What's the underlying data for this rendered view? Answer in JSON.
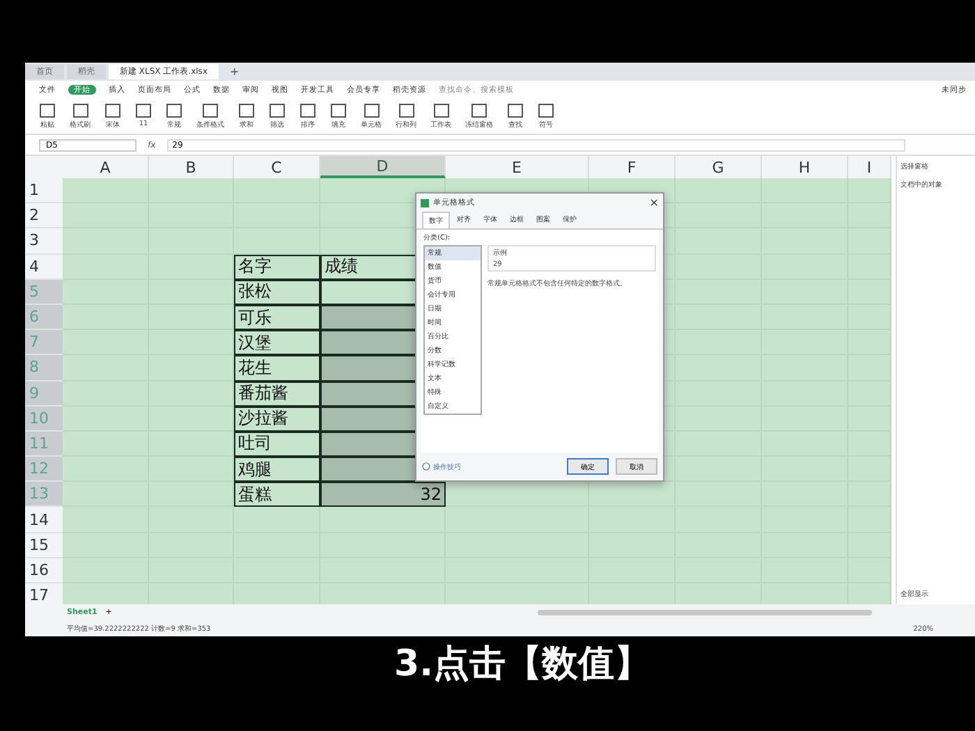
{
  "tabs": [
    {
      "label": "首页",
      "selected": false
    },
    {
      "label": "稻壳",
      "selected": false
    },
    {
      "label": "新建 XLSX 工作表.xlsx",
      "selected": true
    }
  ],
  "menu": [
    {
      "label": "文件",
      "selected": false
    },
    {
      "label": "开始",
      "selected": true
    },
    {
      "label": "插入",
      "selected": false
    },
    {
      "label": "页面布局",
      "selected": false
    },
    {
      "label": "公式",
      "selected": false
    },
    {
      "label": "数据",
      "selected": false
    },
    {
      "label": "审阅",
      "selected": false
    },
    {
      "label": "视图",
      "selected": false
    },
    {
      "label": "开发工具",
      "selected": false
    },
    {
      "label": "会员专享",
      "selected": false
    },
    {
      "label": "稻壳资源",
      "selected": false
    }
  ],
  "search": {
    "placeholder": "查找命令、搜索模板"
  },
  "new_tab": "+",
  "sync": "未同步",
  "toolbar": [
    "粘贴",
    "格式刷",
    "宋体",
    "11",
    "常规",
    "条件格式",
    "求和",
    "筛选",
    "排序",
    "填充",
    "单元格",
    "行和列",
    "工作表",
    "冻结窗格",
    "查找",
    "符号"
  ],
  "formula_bar": {
    "cell_ref": "D5",
    "fx": "fx",
    "value": "29"
  },
  "sheet": {
    "columns": [
      {
        "label": "A",
        "selected": false
      },
      {
        "label": "B",
        "selected": false
      },
      {
        "label": "C",
        "selected": false
      },
      {
        "label": "D",
        "selected": true
      },
      {
        "label": "E",
        "selected": false
      },
      {
        "label": "F",
        "selected": false
      },
      {
        "label": "G",
        "selected": false
      },
      {
        "label": "H",
        "selected": false
      },
      {
        "label": "I",
        "selected": false
      }
    ],
    "rows": [
      {
        "label": "1",
        "selected": false
      },
      {
        "label": "2",
        "selected": false
      },
      {
        "label": "3",
        "selected": false
      },
      {
        "label": "4",
        "selected": false
      },
      {
        "label": "5",
        "selected": true
      },
      {
        "label": "6",
        "selected": true
      },
      {
        "label": "7",
        "selected": true
      },
      {
        "label": "8",
        "selected": true
      },
      {
        "label": "9",
        "selected": true
      },
      {
        "label": "10",
        "selected": true
      },
      {
        "label": "11",
        "selected": true
      },
      {
        "label": "12",
        "selected": true
      },
      {
        "label": "13",
        "selected": true
      },
      {
        "label": "14",
        "selected": false
      },
      {
        "label": "15",
        "selected": false
      },
      {
        "label": "16",
        "selected": false
      },
      {
        "label": "17",
        "selected": false
      }
    ],
    "table": {
      "header": [
        "名字",
        "成绩"
      ],
      "rows": [
        {
          "name": "张松"
        },
        {
          "name": "可乐"
        },
        {
          "name": "汉堡"
        },
        {
          "name": "花生"
        },
        {
          "name": "番茄酱"
        },
        {
          "name": "沙拉酱"
        },
        {
          "name": "吐司"
        },
        {
          "name": "鸡腿"
        },
        {
          "name": "蛋糕",
          "score": "32"
        }
      ]
    }
  },
  "dialog": {
    "title": "单元格格式",
    "close": "×",
    "tabs": [
      {
        "label": "数字",
        "selected": true
      },
      {
        "label": "对齐",
        "selected": false
      },
      {
        "label": "字体",
        "selected": false
      },
      {
        "label": "边框",
        "selected": false
      },
      {
        "label": "图案",
        "selected": false
      },
      {
        "label": "保护",
        "selected": false
      }
    ],
    "category_label": "分类(C):",
    "categories": [
      {
        "label": "常规",
        "selected": true
      },
      {
        "label": "数值",
        "selected": false
      },
      {
        "label": "货币",
        "selected": false
      },
      {
        "label": "会计专用",
        "selected": false
      },
      {
        "label": "日期",
        "selected": false
      },
      {
        "label": "时间",
        "selected": false
      },
      {
        "label": "百分比",
        "selected": false
      },
      {
        "label": "分数",
        "selected": false
      },
      {
        "label": "科学记数",
        "selected": false
      },
      {
        "label": "文本",
        "selected": false
      },
      {
        "label": "特殊",
        "selected": false
      },
      {
        "label": "自定义",
        "selected": false
      }
    ],
    "sample_label": "示例",
    "sample_value": "29",
    "description": "常规单元格格式不包含任何特定的数字格式。",
    "help_link": "操作技巧",
    "buttons": [
      {
        "label": "确定",
        "kind": "primary"
      },
      {
        "label": "取消",
        "kind": "normal"
      }
    ]
  },
  "side_panel": {
    "title": "选择窗格",
    "subtitle": "文档中的对象",
    "footer": "全部显示"
  },
  "sheet_tabs": [
    {
      "label": "Sheet1",
      "selected": true
    }
  ],
  "add_sheet": "+",
  "status_bar": {
    "text": "平均值=39.2222222222 计数=9 求和=353",
    "zoom": "220%"
  },
  "caption": "3.点击【数值】"
}
